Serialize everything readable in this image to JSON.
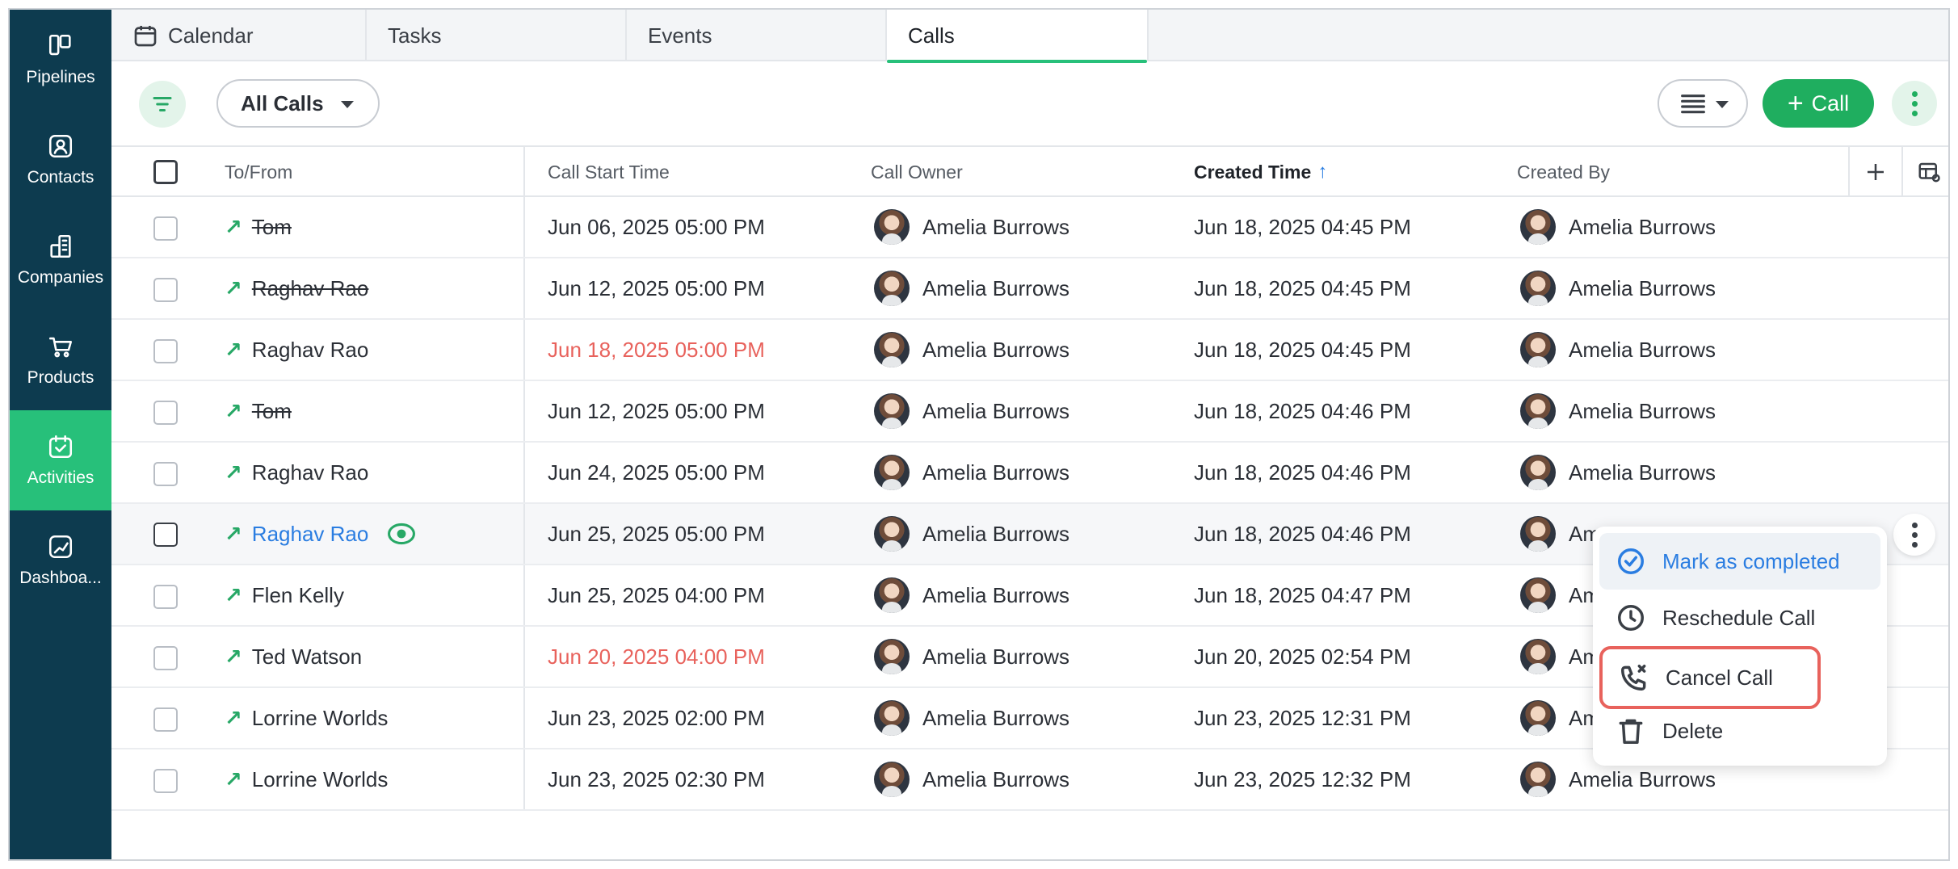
{
  "sidebar": {
    "items": [
      {
        "label": "Pipelines",
        "icon": "pipelines-icon"
      },
      {
        "label": "Contacts",
        "icon": "contacts-icon"
      },
      {
        "label": "Companies",
        "icon": "companies-icon"
      },
      {
        "label": "Products",
        "icon": "products-icon"
      },
      {
        "label": "Activities",
        "icon": "activities-icon",
        "active": true
      },
      {
        "label": "Dashboa...",
        "icon": "dashboard-icon"
      }
    ]
  },
  "tabs": [
    {
      "label": "Calendar"
    },
    {
      "label": "Tasks"
    },
    {
      "label": "Events"
    },
    {
      "label": "Calls",
      "active": true
    }
  ],
  "toolbar": {
    "view_label": "All Calls",
    "add_call_label": "Call"
  },
  "table": {
    "columns": [
      "To/From",
      "Call Start Time",
      "Call Owner",
      "Created Time",
      "Created By"
    ],
    "sorted_column": "Created Time",
    "rows": [
      {
        "to_from": "Tom",
        "start": "Jun 06, 2025 05:00 PM",
        "owner": "Amelia Burrows",
        "created": "Jun 18, 2025 04:45 PM",
        "created_by": "Amelia Burrows",
        "strike": true
      },
      {
        "to_from": "Raghav Rao",
        "start": "Jun 12, 2025 05:00 PM",
        "owner": "Amelia Burrows",
        "created": "Jun 18, 2025 04:45 PM",
        "created_by": "Amelia Burrows",
        "strike": true
      },
      {
        "to_from": "Raghav Rao",
        "start": "Jun 18, 2025 05:00 PM",
        "owner": "Amelia Burrows",
        "created": "Jun 18, 2025 04:45 PM",
        "created_by": "Amelia Burrows",
        "overdue": true
      },
      {
        "to_from": "Tom",
        "start": "Jun 12, 2025 05:00 PM",
        "owner": "Amelia Burrows",
        "created": "Jun 18, 2025 04:46 PM",
        "created_by": "Amelia Burrows",
        "strike": true
      },
      {
        "to_from": "Raghav Rao",
        "start": "Jun 24, 2025 05:00 PM",
        "owner": "Amelia Burrows",
        "created": "Jun 18, 2025 04:46 PM",
        "created_by": "Amelia Burrows"
      },
      {
        "to_from": "Raghav Rao",
        "start": "Jun 25, 2025 05:00 PM",
        "owner": "Amelia Burrows",
        "created": "Jun 18, 2025 04:46 PM",
        "created_by": "Am",
        "hovered": true
      },
      {
        "to_from": "Flen Kelly",
        "start": "Jun 25, 2025 04:00 PM",
        "owner": "Amelia Burrows",
        "created": "Jun 18, 2025 04:47 PM",
        "created_by": "Am"
      },
      {
        "to_from": "Ted Watson",
        "start": "Jun 20, 2025 04:00 PM",
        "owner": "Amelia Burrows",
        "created": "Jun 20, 2025 02:54 PM",
        "created_by": "Am",
        "overdue": true
      },
      {
        "to_from": "Lorrine Worlds",
        "start": "Jun 23, 2025 02:00 PM",
        "owner": "Amelia Burrows",
        "created": "Jun 23, 2025 12:31 PM",
        "created_by": "Am"
      },
      {
        "to_from": "Lorrine Worlds",
        "start": "Jun 23, 2025 02:30 PM",
        "owner": "Amelia Burrows",
        "created": "Jun 23, 2025 12:32 PM",
        "created_by": "Amelia Burrows"
      }
    ]
  },
  "context_menu": {
    "items": [
      {
        "label": "Mark as completed",
        "icon": "check-circle-icon"
      },
      {
        "label": "Reschedule Call",
        "icon": "clock-icon"
      },
      {
        "label": "Cancel Call",
        "icon": "phone-cancel-icon"
      },
      {
        "label": "Delete",
        "icon": "trash-icon"
      }
    ]
  },
  "colors": {
    "sidebar_bg": "#0d3b4f",
    "accent_green": "#1fae5f",
    "active_nav": "#27c07a",
    "link_blue": "#2a7de1",
    "overdue_red": "#e8625c"
  }
}
